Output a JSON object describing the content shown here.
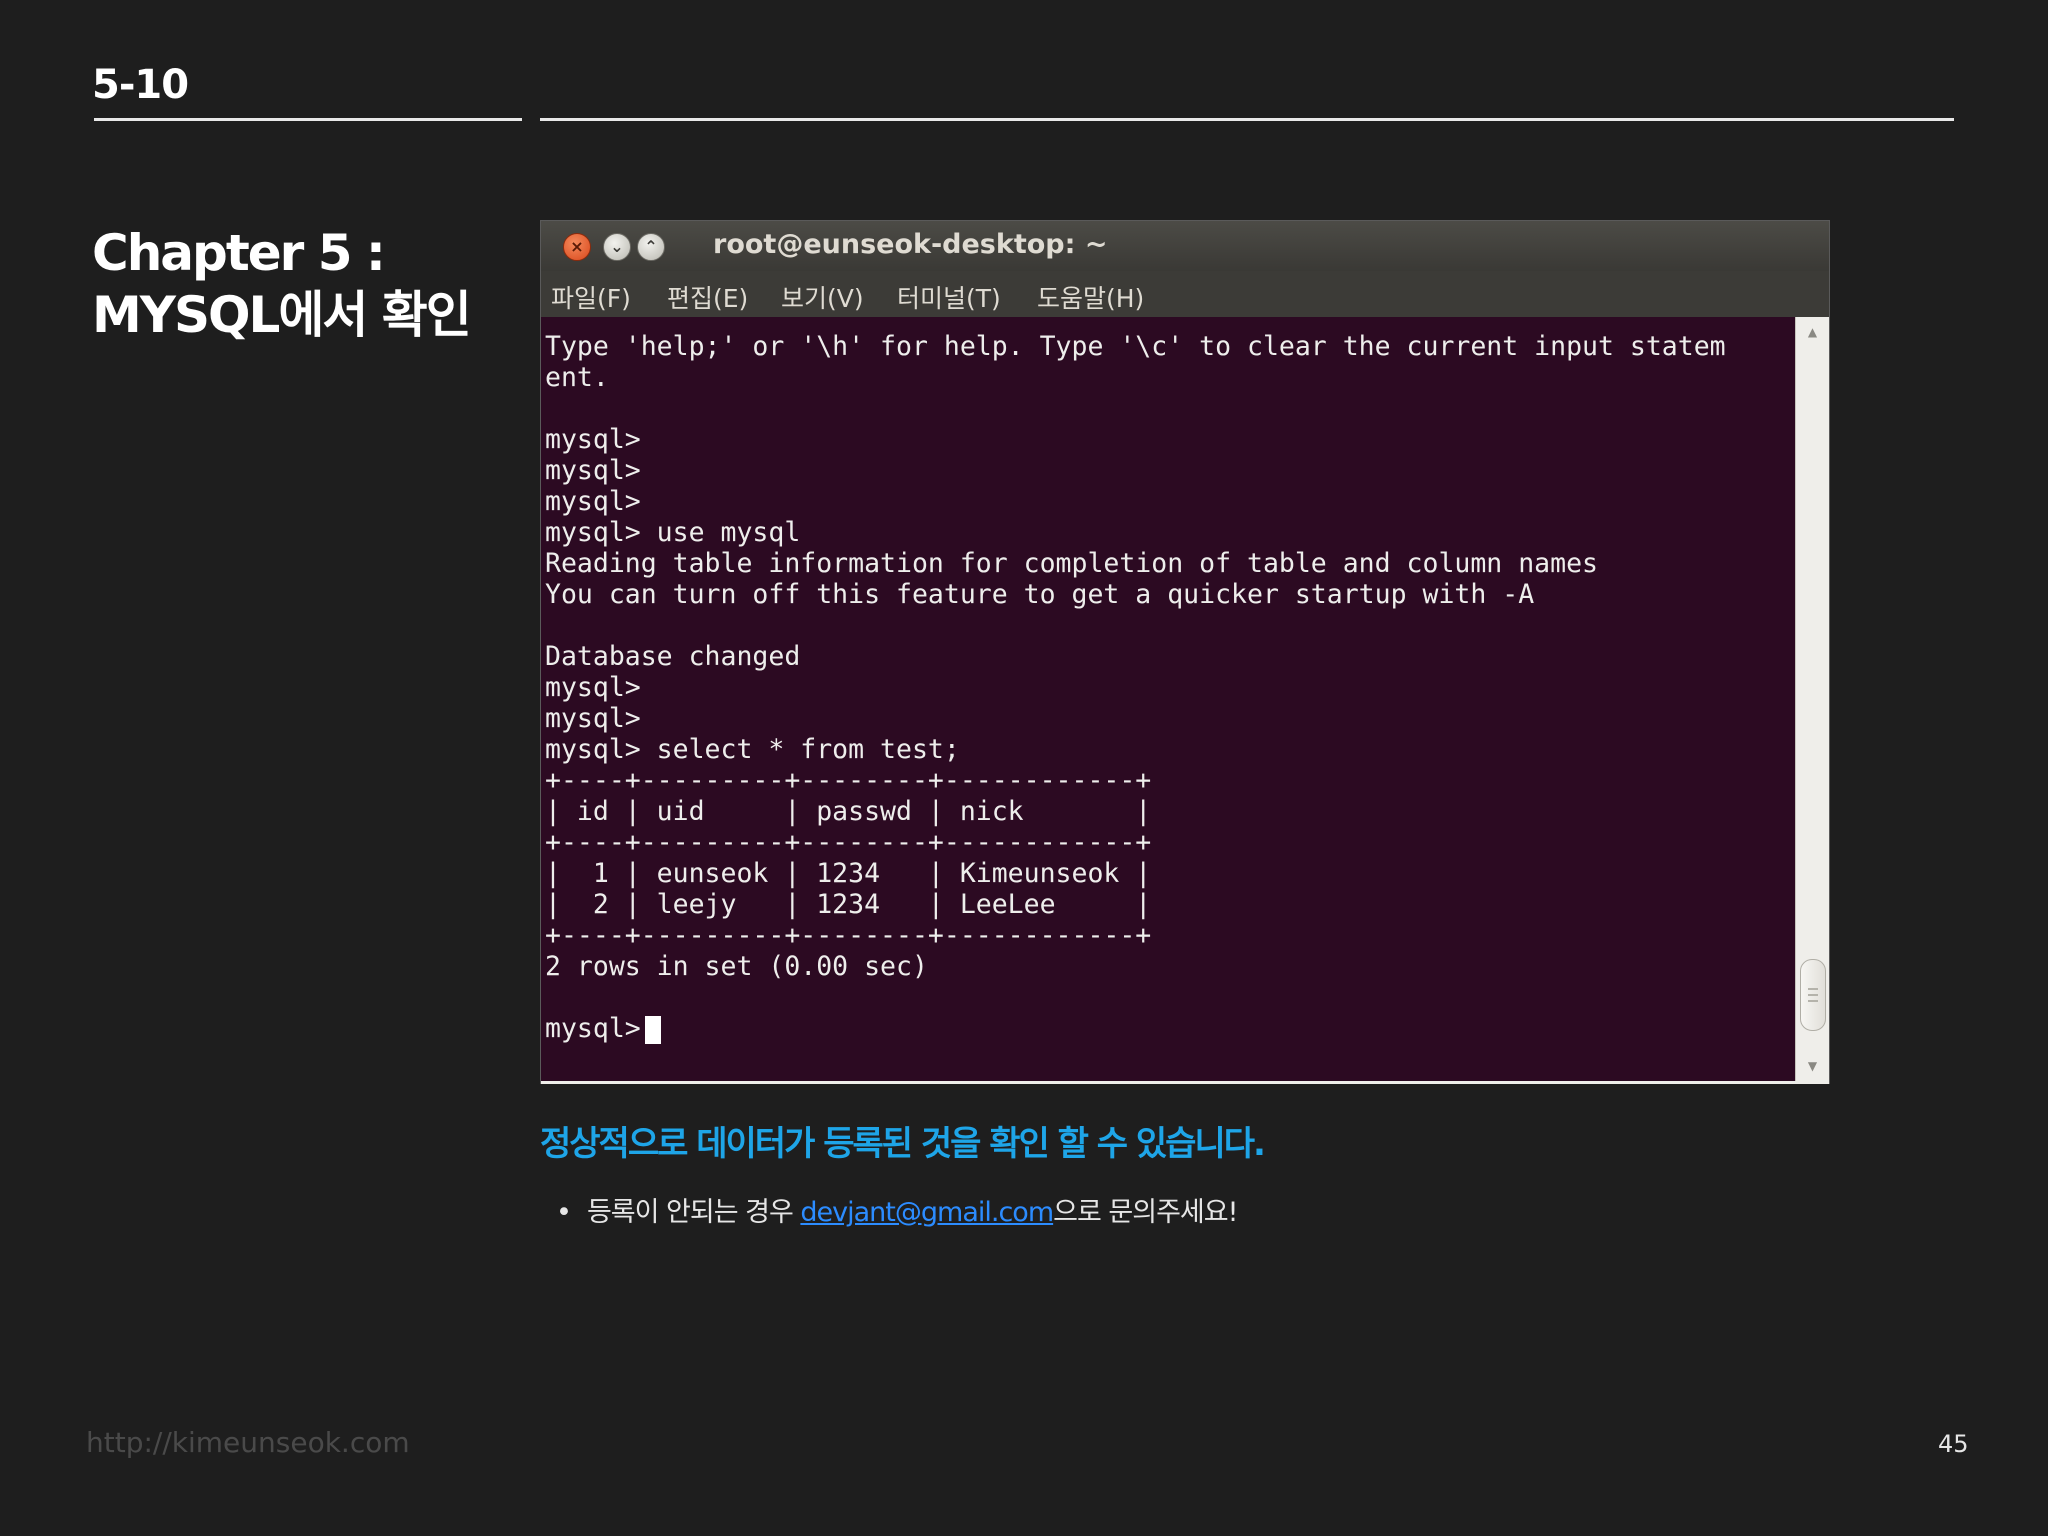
{
  "header": {
    "section_number": "5-10"
  },
  "chapter": {
    "line1": "Chapter 5 :",
    "line2": "MYSQL에서 확인"
  },
  "terminal": {
    "title": "root@eunseok-desktop: ~",
    "window_buttons": {
      "close": "×",
      "minimize": "⌄",
      "maximize": "⌃"
    },
    "menu": [
      "파일(F)",
      "편집(E)",
      "보기(V)",
      "터미널(T)",
      "도움말(H)"
    ],
    "lines": [
      "Type 'help;' or '\\h' for help. Type '\\c' to clear the current input statem",
      "ent.",
      "",
      "mysql>",
      "mysql>",
      "mysql>",
      "mysql> use mysql",
      "Reading table information for completion of table and column names",
      "You can turn off this feature to get a quicker startup with -A",
      "",
      "Database changed",
      "mysql>",
      "mysql>",
      "mysql> select * from test;",
      "+----+---------+--------+------------+",
      "| id | uid     | passwd | nick       |",
      "+----+---------+--------+------------+",
      "|  1 | eunseok | 1234   | Kimeunseok |",
      "|  2 | leejy   | 1234   | LeeLee     |",
      "+----+---------+--------+------------+",
      "2 rows in set (0.00 sec)",
      ""
    ],
    "prompt": "mysql>",
    "table": {
      "headers": [
        "id",
        "uid",
        "passwd",
        "nick"
      ],
      "rows": [
        [
          "1",
          "eunseok",
          "1234",
          "Kimeunseok"
        ],
        [
          "2",
          "leejy",
          "1234",
          "LeeLee"
        ]
      ]
    },
    "scrollbar": {
      "up_arrow": "▲",
      "down_arrow": "▼"
    }
  },
  "caption": "정상적으로 데이터가 등록된 것을 확인 할 수 있습니다.",
  "note": {
    "bullet": "•",
    "prefix": "등록이 안되는 경우 ",
    "email": "devjant@gmail.com",
    "suffix": "으로 문의주세요!"
  },
  "footer": {
    "url": "http://kimeunseok.com",
    "page_number": "45"
  },
  "colors": {
    "background": "#1e1e1e",
    "terminal_bg": "#2c0a22",
    "caption": "#1ea5e8",
    "link": "#2c8cff"
  }
}
